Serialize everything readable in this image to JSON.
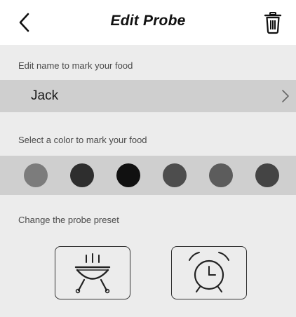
{
  "header": {
    "title": "Edit Probe",
    "back_icon": "chevron-left-icon",
    "delete_icon": "trash-icon"
  },
  "name_section": {
    "label": "Edit name to mark your food",
    "value": "Jack",
    "chevron_icon": "chevron-right-icon"
  },
  "color_section": {
    "label": "Select a color to mark your food",
    "colors": [
      "#7c7c7c",
      "#2e2e2e",
      "#111111",
      "#4d4d4d",
      "#5c5c5c",
      "#444444"
    ]
  },
  "preset_section": {
    "label": "Change the probe preset",
    "options": [
      {
        "icon": "grill-icon"
      },
      {
        "icon": "alarm-clock-icon"
      }
    ]
  },
  "colors": {
    "header_bg": "#ffffff",
    "panel_bg": "#ececec",
    "row_bg": "#cfcfcf"
  }
}
